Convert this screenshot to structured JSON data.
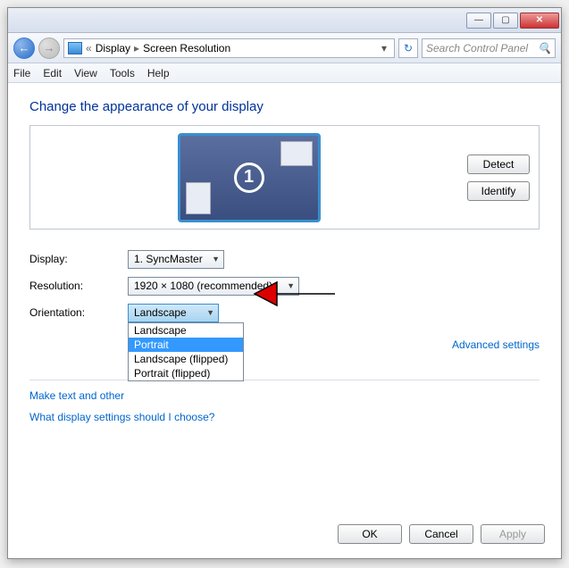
{
  "titlebar": {
    "min": "—",
    "max": "▢",
    "close": "✕"
  },
  "nav": {
    "back": "←",
    "fwd": "→",
    "sep": "«",
    "crumb1": "Display",
    "crumb2": "Screen Resolution",
    "dropdown_arrow": "▾",
    "refresh": "↻",
    "search_placeholder": "Search Control Panel",
    "search_icon": "🔍"
  },
  "menu": [
    "File",
    "Edit",
    "View",
    "Tools",
    "Help"
  ],
  "heading": "Change the appearance of your display",
  "monitor_number": "1",
  "buttons": {
    "detect": "Detect",
    "identify": "Identify"
  },
  "form": {
    "display_label": "Display:",
    "display_value": "1. SyncMaster",
    "resolution_label": "Resolution:",
    "resolution_value": "1920 × 1080 (recommended)",
    "orientation_label": "Orientation:",
    "orientation_value": "Landscape",
    "orientation_options": [
      "Landscape",
      "Portrait",
      "Landscape (flipped)",
      "Portrait (flipped)"
    ],
    "orientation_selected_index": 1
  },
  "links": {
    "advanced": "Advanced settings",
    "link1": "Make text and other",
    "link2": "What display settings should I choose?"
  },
  "footer": {
    "ok": "OK",
    "cancel": "Cancel",
    "apply": "Apply"
  }
}
